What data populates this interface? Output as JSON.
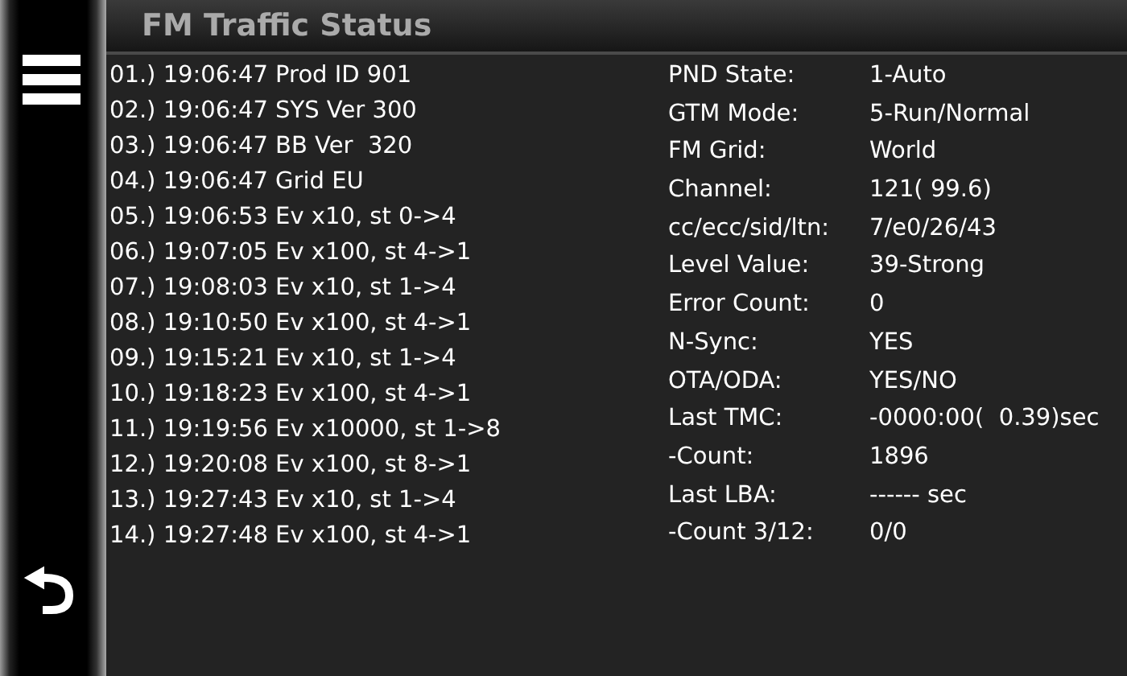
{
  "title": "FM Traffic Status",
  "log": [
    "01.) 19:06:47 Prod ID 901",
    "02.) 19:06:47 SYS Ver 300",
    "03.) 19:06:47 BB Ver  320",
    "04.) 19:06:47 Grid EU",
    "05.) 19:06:53 Ev x10, st 0->4",
    "06.) 19:07:05 Ev x100, st 4->1",
    "07.) 19:08:03 Ev x10, st 1->4",
    "08.) 19:10:50 Ev x100, st 4->1",
    "09.) 19:15:21 Ev x10, st 1->4",
    "10.) 19:18:23 Ev x100, st 4->1",
    "11.) 19:19:56 Ev x10000, st 1->8",
    "12.) 19:20:08 Ev x100, st 8->1",
    "13.) 19:27:43 Ev x10, st 1->4",
    "14.) 19:27:48 Ev x100, st 4->1"
  ],
  "status": [
    {
      "label": "PND State:",
      "value": "1-Auto"
    },
    {
      "label": "GTM Mode:",
      "value": "5-Run/Normal"
    },
    {
      "label": "FM Grid:",
      "value": "World"
    },
    {
      "label": "Channel:",
      "value": "121( 99.6)"
    },
    {
      "label": "cc/ecc/sid/ltn:",
      "value": "7/e0/26/43"
    },
    {
      "label": "Level Value:",
      "value": "39-Strong"
    },
    {
      "label": "Error Count:",
      "value": "0"
    },
    {
      "label": "N-Sync:",
      "value": "YES"
    },
    {
      "label": "OTA/ODA:",
      "value": "YES/NO"
    },
    {
      "label": "Last TMC:",
      "value": "-0000:00(  0.39)sec"
    },
    {
      "label": "-Count:",
      "value": "1896"
    },
    {
      "label": "Last LBA:",
      "value": "------ sec"
    },
    {
      "label": "-Count 3/12:",
      "value": "0/0"
    }
  ]
}
